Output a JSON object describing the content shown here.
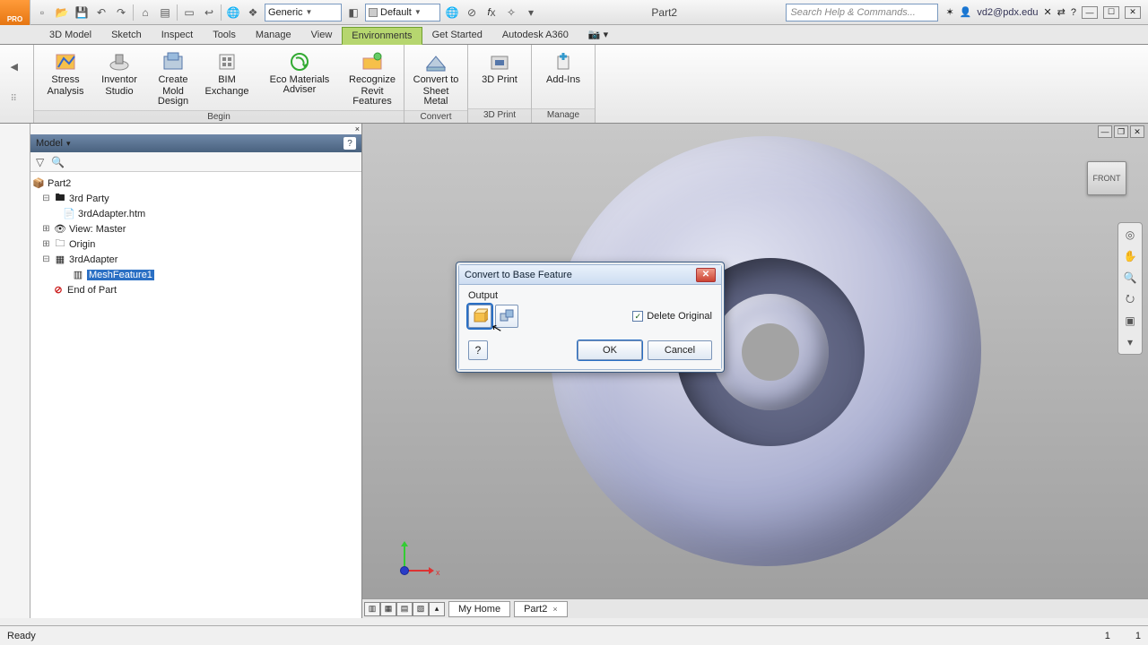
{
  "title": "Part2",
  "app_badge": "PRO",
  "qat_icons": [
    "new",
    "open",
    "save",
    "undo",
    "redo",
    "|",
    "home",
    "print",
    "|",
    "select",
    "measure",
    "|",
    "web",
    "help"
  ],
  "combos": {
    "material": "Generic",
    "appearance": "Default"
  },
  "search_placeholder": "Search Help & Commands...",
  "user": "vd2@pdx.edu",
  "ribbon_tabs": [
    "3D Model",
    "Sketch",
    "Inspect",
    "Tools",
    "Manage",
    "View",
    "Environments",
    "Get Started",
    "Autodesk A360"
  ],
  "active_tab": "Environments",
  "ribbon": {
    "groups": [
      {
        "label": "Begin",
        "items": [
          {
            "id": "stress",
            "line1": "Stress",
            "line2": "Analysis"
          },
          {
            "id": "studio",
            "line1": "Inventor",
            "line2": "Studio"
          },
          {
            "id": "mold",
            "line1": "Create",
            "line2": "Mold Design"
          },
          {
            "id": "bim",
            "line1": "BIM",
            "line2": "Exchange"
          },
          {
            "id": "eco",
            "line1": "Eco Materials Adviser",
            "line2": "",
            "wide": true
          },
          {
            "id": "revit",
            "line1": "Recognize",
            "line2": "Revit Features"
          }
        ]
      },
      {
        "label": "Convert",
        "items": [
          {
            "id": "sheetmetal",
            "line1": "Convert to",
            "line2": "Sheet Metal"
          }
        ]
      },
      {
        "label": "3D Print",
        "items": [
          {
            "id": "3dprint",
            "line1": "3D Print",
            "line2": ""
          }
        ]
      },
      {
        "label": "Manage",
        "items": [
          {
            "id": "addins",
            "line1": "Add-Ins",
            "line2": ""
          }
        ]
      }
    ]
  },
  "browser": {
    "header": "Model",
    "tree": {
      "root": "Part2",
      "thirdparty": "3rd Party",
      "adapter_htm": "3rdAdapter.htm",
      "view": "View: Master",
      "origin": "Origin",
      "adapter": "3rdAdapter",
      "meshfeature": "MeshFeature1",
      "end": "End of Part"
    }
  },
  "viewcube": "FRONT",
  "doctabs": [
    "My Home",
    "Part2"
  ],
  "dialog": {
    "title": "Convert to Base Feature",
    "output_label": "Output",
    "delete_original": "Delete Original",
    "ok": "OK",
    "cancel": "Cancel"
  },
  "status": {
    "left": "Ready",
    "right1": "1",
    "right2": "1"
  }
}
